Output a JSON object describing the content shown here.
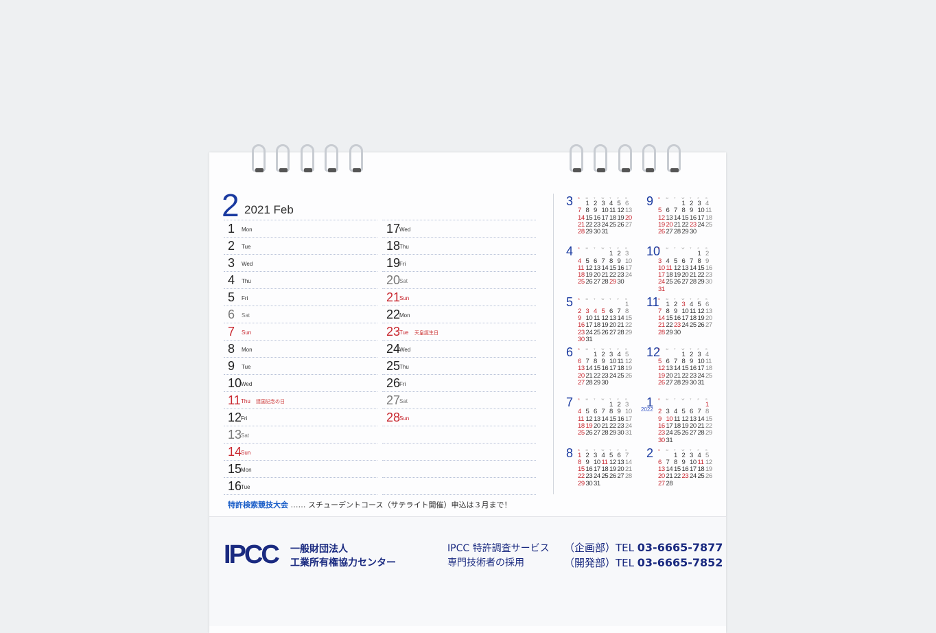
{
  "main_month": {
    "number": "2",
    "year_label": "2021 Feb"
  },
  "days_left": [
    {
      "d": "1",
      "dow": "Mon",
      "t": ""
    },
    {
      "d": "2",
      "dow": "Tue",
      "t": ""
    },
    {
      "d": "3",
      "dow": "Wed",
      "t": ""
    },
    {
      "d": "4",
      "dow": "Thu",
      "t": ""
    },
    {
      "d": "5",
      "dow": "Fri",
      "t": ""
    },
    {
      "d": "6",
      "dow": "Sat",
      "t": "sat"
    },
    {
      "d": "7",
      "dow": "Sun",
      "t": "red"
    },
    {
      "d": "8",
      "dow": "Mon",
      "t": ""
    },
    {
      "d": "9",
      "dow": "Tue",
      "t": ""
    },
    {
      "d": "10",
      "dow": "Wed",
      "t": ""
    },
    {
      "d": "11",
      "dow": "Thu",
      "t": "red",
      "holiday": "建国記念の日"
    },
    {
      "d": "12",
      "dow": "Fri",
      "t": ""
    },
    {
      "d": "13",
      "dow": "Sat",
      "t": "sat"
    },
    {
      "d": "14",
      "dow": "Sun",
      "t": "red"
    },
    {
      "d": "15",
      "dow": "Mon",
      "t": ""
    },
    {
      "d": "16",
      "dow": "Tue",
      "t": ""
    }
  ],
  "days_right": [
    {
      "d": "17",
      "dow": "Wed",
      "t": ""
    },
    {
      "d": "18",
      "dow": "Thu",
      "t": ""
    },
    {
      "d": "19",
      "dow": "Fri",
      "t": ""
    },
    {
      "d": "20",
      "dow": "Sat",
      "t": "sat"
    },
    {
      "d": "21",
      "dow": "Sun",
      "t": "red"
    },
    {
      "d": "22",
      "dow": "Mon",
      "t": ""
    },
    {
      "d": "23",
      "dow": "Tue",
      "t": "red",
      "holiday": "天皇誕生日"
    },
    {
      "d": "24",
      "dow": "Wed",
      "t": ""
    },
    {
      "d": "25",
      "dow": "Thu",
      "t": ""
    },
    {
      "d": "26",
      "dow": "Fri",
      "t": ""
    },
    {
      "d": "27",
      "dow": "Sat",
      "t": "sat"
    },
    {
      "d": "28",
      "dow": "Sun",
      "t": "red"
    },
    {
      "d": "",
      "dow": "",
      "t": ""
    },
    {
      "d": "",
      "dow": "",
      "t": ""
    },
    {
      "d": "",
      "dow": "",
      "t": ""
    },
    {
      "d": "",
      "dow": "",
      "t": ""
    }
  ],
  "note": {
    "heading": "特許検索競技大会",
    "text": " …… スチューデントコース（サテライト開催）申込は３月まで！"
  },
  "weekday_headers": [
    "S",
    "M",
    "T",
    "W",
    "T",
    "F",
    "S"
  ],
  "mini_calendars": [
    {
      "label": "3",
      "year": 2021,
      "month": 3,
      "holidays": [
        20
      ]
    },
    {
      "label": "9",
      "year": 2021,
      "month": 9,
      "holidays": [
        20,
        23
      ]
    },
    {
      "label": "4",
      "year": 2021,
      "month": 4,
      "holidays": [
        29
      ]
    },
    {
      "label": "10",
      "year": 2021,
      "month": 10,
      "holidays": [
        11
      ]
    },
    {
      "label": "5",
      "year": 2021,
      "month": 5,
      "holidays": [
        3,
        4,
        5
      ]
    },
    {
      "label": "11",
      "year": 2021,
      "month": 11,
      "holidays": [
        3,
        23
      ]
    },
    {
      "label": "6",
      "year": 2021,
      "month": 6,
      "holidays": []
    },
    {
      "label": "12",
      "year": 2021,
      "month": 12,
      "holidays": []
    },
    {
      "label": "7",
      "year": 2021,
      "month": 7,
      "holidays": [
        19
      ]
    },
    {
      "label": "1",
      "year": 2022,
      "month": 1,
      "holidays": [
        1,
        10
      ],
      "year_label": "2022"
    },
    {
      "label": "8",
      "year": 2021,
      "month": 8,
      "holidays": [
        11
      ]
    },
    {
      "label": "2",
      "year": 2022,
      "month": 2,
      "holidays": [
        11,
        23
      ]
    }
  ],
  "footer": {
    "logo": "IPCC",
    "org_line1": "一般財団法人",
    "org_line2": "工業所有権協力センター",
    "service_line1": "IPCC 特許調査サービス",
    "service_line2": "専門技術者の採用",
    "dept1": "（企画部）TEL ",
    "tel1": "03-6665-7877",
    "dept2": "（開発部）TEL ",
    "tel2": "03-6665-7852"
  },
  "colors": {
    "brand_blue": "#1a2a80",
    "month_blue": "#1a3aa0",
    "holiday_red": "#c8262e",
    "saturday_gray": "#888888"
  }
}
